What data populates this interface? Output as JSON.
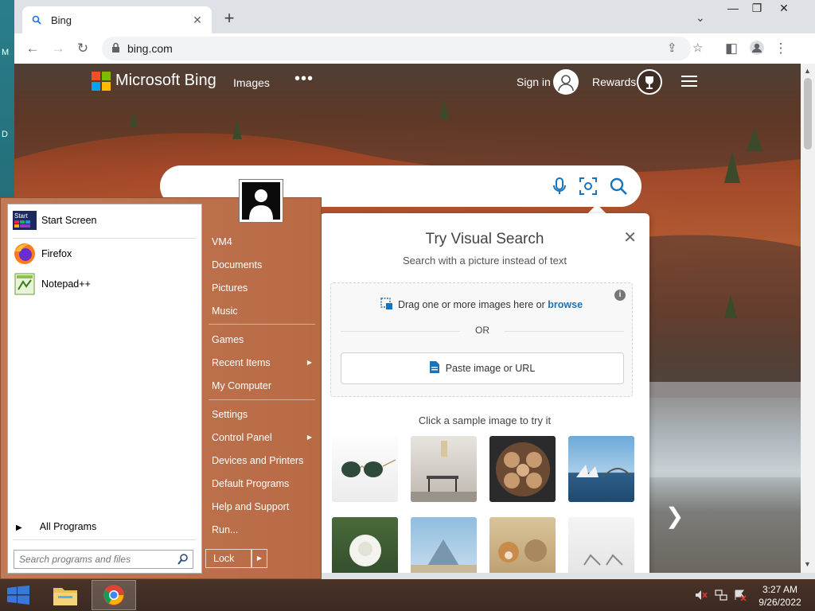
{
  "desktop": {
    "edge_letters": [
      "M",
      "D"
    ]
  },
  "browser": {
    "tab": {
      "title": "Bing"
    },
    "omnibox": {
      "url": "bing.com"
    }
  },
  "bing": {
    "brand": "Microsoft Bing",
    "nav_images": "Images",
    "nav_more": "•••",
    "sign_in": "Sign in",
    "rewards": "Rewards",
    "visual_search": {
      "title": "Try Visual Search",
      "subtitle": "Search with a picture instead of text",
      "drag_text": "Drag one or more images here or",
      "browse": "browse",
      "or": "OR",
      "paste": "Paste image or URL",
      "sample_label": "Click a sample image to try it",
      "samples": [
        "sunglasses",
        "dining room",
        "latte art",
        "Sydney Opera House",
        "white rose",
        "Louvre",
        "dogs",
        "white chairs"
      ]
    }
  },
  "start_menu": {
    "pinned": [
      {
        "label": "Start Screen",
        "icon": "start-screen-icon"
      },
      {
        "label": "Firefox",
        "icon": "firefox-icon"
      },
      {
        "label": "Notepad++",
        "icon": "notepadpp-icon"
      }
    ],
    "start_icon_text": "Start",
    "all_programs": "All Programs",
    "search_placeholder": "Search programs and files",
    "right_items": [
      "VM4",
      "Documents",
      "Pictures",
      "Music",
      "Games",
      "Recent Items",
      "My Computer",
      "Settings",
      "Control Panel",
      "Devices and Printers",
      "Default Programs",
      "Help and Support",
      "Run..."
    ],
    "lock": "Lock"
  },
  "taskbar": {
    "time": "3:27 AM",
    "date": "9/26/2022"
  },
  "colors": {
    "start_menu_bg": "#b86a44",
    "bing_blue": "#1a73b8"
  }
}
